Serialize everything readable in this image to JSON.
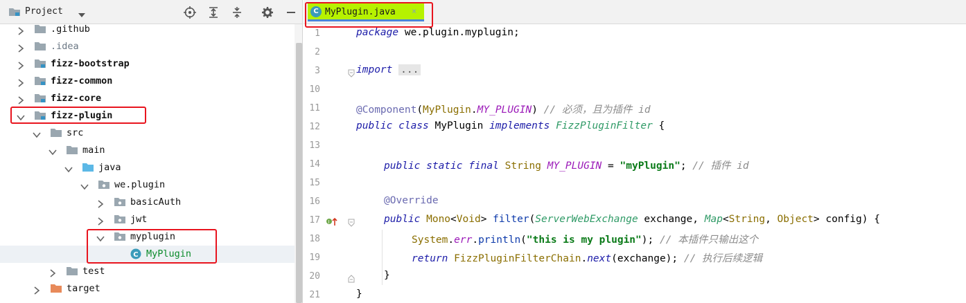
{
  "panel": {
    "title": "Project",
    "toolbar": [
      "locate-icon",
      "expand-all-icon",
      "collapse-all-icon",
      "gear-icon",
      "minimize-icon"
    ]
  },
  "tree": [
    {
      "label": ".github",
      "depth": 0,
      "expanded": false,
      "icon": "folder",
      "style": "plain"
    },
    {
      "label": ".idea",
      "depth": 0,
      "expanded": false,
      "icon": "folder",
      "style": "dim"
    },
    {
      "label": "fizz-bootstrap",
      "depth": 0,
      "expanded": false,
      "icon": "module",
      "style": "bold"
    },
    {
      "label": "fizz-common",
      "depth": 0,
      "expanded": false,
      "icon": "module",
      "style": "bold"
    },
    {
      "label": "fizz-core",
      "depth": 0,
      "expanded": false,
      "icon": "module",
      "style": "bold"
    },
    {
      "label": "fizz-plugin",
      "depth": 0,
      "expanded": true,
      "icon": "module",
      "style": "bold"
    },
    {
      "label": "src",
      "depth": 1,
      "expanded": true,
      "icon": "folder",
      "style": "plain"
    },
    {
      "label": "main",
      "depth": 2,
      "expanded": true,
      "icon": "folder",
      "style": "plain"
    },
    {
      "label": "java",
      "depth": 3,
      "expanded": true,
      "icon": "source-folder",
      "style": "plain"
    },
    {
      "label": "we.plugin",
      "depth": 4,
      "expanded": true,
      "icon": "package",
      "style": "plain"
    },
    {
      "label": "basicAuth",
      "depth": 5,
      "expanded": false,
      "icon": "package",
      "style": "plain"
    },
    {
      "label": "jwt",
      "depth": 5,
      "expanded": false,
      "icon": "package",
      "style": "plain"
    },
    {
      "label": "myplugin",
      "depth": 5,
      "expanded": true,
      "icon": "package",
      "style": "plain"
    },
    {
      "label": "MyPlugin",
      "depth": 6,
      "expanded": null,
      "icon": "class",
      "style": "green"
    },
    {
      "label": "test",
      "depth": 2,
      "expanded": false,
      "icon": "folder",
      "style": "plain"
    },
    {
      "label": "target",
      "depth": 1,
      "expanded": false,
      "icon": "target-folder",
      "style": "plain"
    }
  ],
  "editor": {
    "tab": {
      "label": "MyPlugin.java",
      "icon": "class-c-icon",
      "close": "×"
    },
    "line_numbers": [
      "1",
      "2",
      "3",
      "10",
      "11",
      "12",
      "13",
      "14",
      "15",
      "16",
      "17",
      "18",
      "19",
      "20",
      "21"
    ],
    "code": {
      "l1_kw": "package",
      "l1_rest": " we.plugin.myplugin;",
      "l3_kw": "import",
      "l3_fold": "...",
      "l11_ann": "@Component",
      "l11_open": "(",
      "l11_cls": "MyPlugin",
      "l11_dot": ".",
      "l11_const": "MY_PLUGIN",
      "l11_close": ")",
      "l11_cmt": " // 必须，且为插件 id",
      "l12_kw1": "public class",
      "l12_name": " MyPlugin ",
      "l12_kw2": "implements",
      "l12_itf": " FizzPluginFilter",
      "l12_brace": " {",
      "l14_kw": "public static final",
      "l14_type": " String",
      "l14_const": " MY_PLUGIN",
      "l14_eq": " = ",
      "l14_str": "\"myPlugin\"",
      "l14_semi": ";",
      "l14_cmt": " // 插件 id",
      "l16_ann": "@Override",
      "l17_kw": "public",
      "l17_type1": " Mono",
      "l17_lt": "<",
      "l17_void": "Void",
      "l17_gt": "> ",
      "l17_mth": "filter",
      "l17_p1": "(",
      "l17_itf1": "ServerWebExchange",
      "l17_arg1": " exchange, ",
      "l17_itf2": "Map",
      "l17_lt2": "<",
      "l17_type2": "String",
      "l17_comma": ", ",
      "l17_type3": "Object",
      "l17_gt2": ">",
      "l17_arg2": " config) {",
      "l18_cls": "System",
      "l18_dot": ".",
      "l18_err": "err",
      "l18_dot2": ".",
      "l18_mth": "println",
      "l18_p": "(",
      "l18_str": "\"this is my plugin\"",
      "l18_end": ");",
      "l18_cmt": " // 本插件只输出这个",
      "l19_kw": "return",
      "l19_cls": " FizzPluginFilterChain",
      "l19_dot": ".",
      "l19_stat": "next",
      "l19_args": "(exchange);",
      "l19_cmt": " // 执行后续逻辑",
      "l20": "}",
      "l21": "}"
    }
  },
  "colors": {
    "highlight_box": "#e8141e",
    "tab_bg": "#b6f200",
    "selection": "#edf1f5"
  }
}
